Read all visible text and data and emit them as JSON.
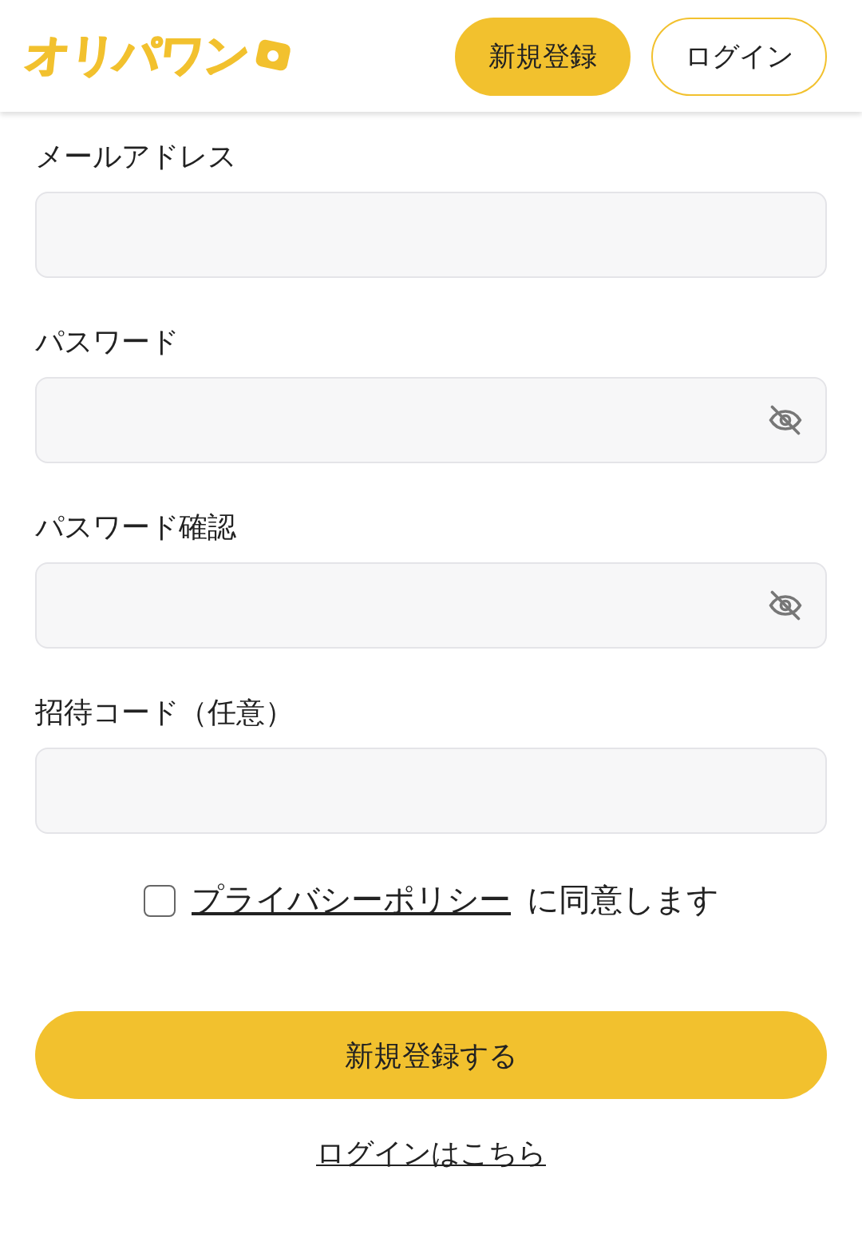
{
  "header": {
    "logo": "オリパワン",
    "buttons": [
      {
        "label": "新規登録",
        "kind": "primary"
      },
      {
        "label": "ログイン",
        "kind": "outline"
      }
    ]
  },
  "fields": [
    {
      "label": "メールアドレス",
      "kind": "text"
    },
    {
      "label": "パスワード",
      "kind": "password"
    },
    {
      "label": "パスワード確認",
      "kind": "password"
    },
    {
      "label": "招待コード（任意）",
      "kind": "text"
    }
  ],
  "agreement": {
    "checked": false,
    "link": "プライバシーポリシー",
    "text": "に同意します"
  },
  "submit": "新規登録する",
  "login_link": "ログインはこちら"
}
